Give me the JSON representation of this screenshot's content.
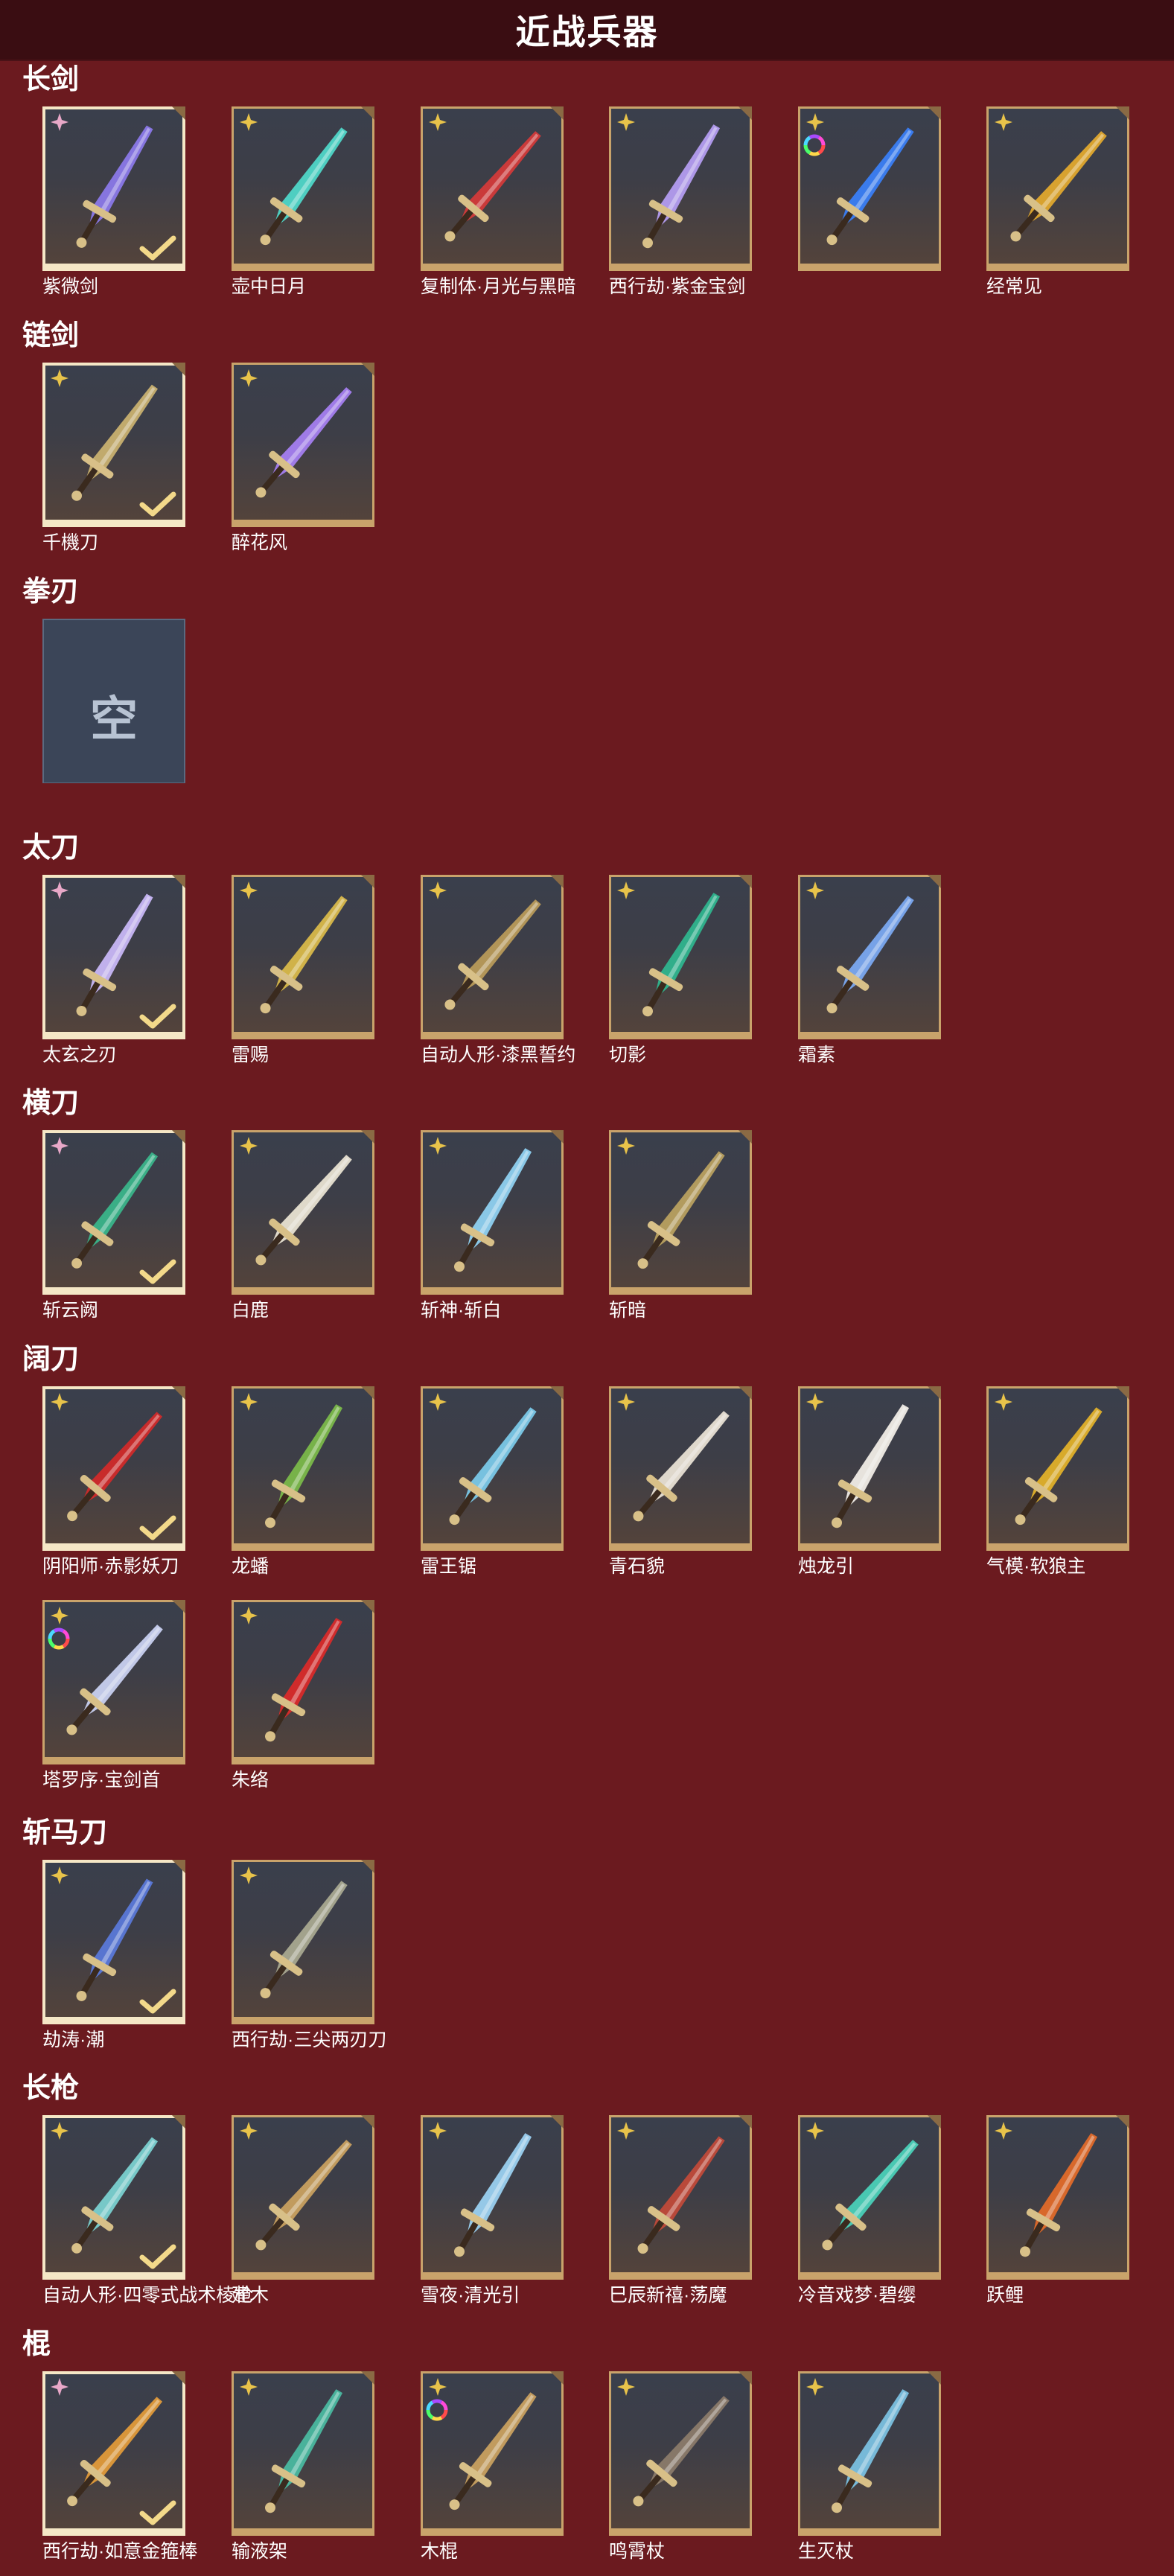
{
  "header": {
    "title": "近战兵器"
  },
  "colors": {
    "background": "#6b1a1f",
    "header_bg": "#3a0d12",
    "card_frame": "#c9a36b",
    "card_frame_selected": "#f5e7c6",
    "rare_tag": "#e8a8c8",
    "normal_tag": "#e8c34a"
  },
  "categories": [
    {
      "title": "长剑",
      "items": [
        {
          "name": "紫微剑",
          "selected": true,
          "tag": "pink-star-icon",
          "art_color": "#8a78e8",
          "ring": false
        },
        {
          "name": "壶中日月",
          "selected": false,
          "tag": "gold-star-icon",
          "art_color": "#4fd6c8",
          "ring": false
        },
        {
          "name": "复制体·月光与黑暗",
          "selected": false,
          "tag": "gold-star-icon",
          "art_color": "#d23a3a",
          "ring": false
        },
        {
          "name": "西行劫·紫金宝剑",
          "selected": false,
          "tag": "gold-star-icon",
          "art_color": "#b39cf0",
          "ring": false
        },
        {
          "name": "",
          "selected": false,
          "tag": "gold-star-icon",
          "art_color": "#3a7ef5",
          "ring": true
        },
        {
          "name": "经常见",
          "selected": false,
          "tag": "gold-star-icon",
          "art_color": "#e0a82e",
          "ring": false
        }
      ]
    },
    {
      "title": "链剑",
      "items": [
        {
          "name": "千機刀",
          "selected": true,
          "tag": "gold-star-icon",
          "art_color": "#c8b070",
          "ring": false
        },
        {
          "name": "醉花风",
          "selected": false,
          "tag": "gold-star-icon",
          "art_color": "#a47ef0",
          "ring": false
        }
      ]
    },
    {
      "title": "拳刃",
      "empty": true,
      "empty_label": "空",
      "items": []
    },
    {
      "title": "太刀",
      "items": [
        {
          "name": "太玄之刃",
          "selected": true,
          "tag": "pink-star-icon",
          "art_color": "#c7b6f5",
          "ring": false
        },
        {
          "name": "雷赐",
          "selected": false,
          "tag": "gold-star-icon",
          "art_color": "#d8b84a",
          "ring": false
        },
        {
          "name": "自动人形·漆黑誓约",
          "selected": false,
          "tag": "gold-star-icon",
          "art_color": "#b89a5a",
          "ring": false
        },
        {
          "name": "切影",
          "selected": false,
          "tag": "gold-star-icon",
          "art_color": "#2fb48e",
          "ring": false
        },
        {
          "name": "霜素",
          "selected": false,
          "tag": "gold-star-icon",
          "art_color": "#7aa8f0",
          "ring": false
        }
      ]
    },
    {
      "title": "横刀",
      "items": [
        {
          "name": "斩云阙",
          "selected": true,
          "tag": "pink-star-icon",
          "art_color": "#3ab48a",
          "ring": false
        },
        {
          "name": "白鹿",
          "selected": false,
          "tag": "gold-star-icon",
          "art_color": "#e8e2d2",
          "ring": false
        },
        {
          "name": "斩神·斩白",
          "selected": false,
          "tag": "gold-star-icon",
          "art_color": "#8ed0f0",
          "ring": false
        },
        {
          "name": "斩暗",
          "selected": false,
          "tag": "gold-star-icon",
          "art_color": "#b8a060",
          "ring": false
        }
      ]
    },
    {
      "title": "阔刀",
      "items": [
        {
          "name": "阴阳师·赤影妖刀",
          "selected": true,
          "tag": "gold-star-icon",
          "art_color": "#d02a2a",
          "ring": false
        },
        {
          "name": "龙蟠",
          "selected": false,
          "tag": "gold-star-icon",
          "art_color": "#7ab84a",
          "ring": false
        },
        {
          "name": "雷王锯",
          "selected": false,
          "tag": "gold-star-icon",
          "art_color": "#7ac8e8",
          "ring": false
        },
        {
          "name": "青石貌",
          "selected": false,
          "tag": "gold-star-icon",
          "art_color": "#e8e0d4",
          "ring": false
        },
        {
          "name": "烛龙引",
          "selected": false,
          "tag": "gold-star-icon",
          "art_color": "#f0ece6",
          "ring": false
        },
        {
          "name": "气模·软狼主",
          "selected": false,
          "tag": "gold-star-icon",
          "art_color": "#e0b02a",
          "ring": false
        },
        {
          "name": "塔罗序·宝剑首",
          "selected": false,
          "tag": "gold-star-icon",
          "art_color": "#c8d0f0",
          "ring": true
        },
        {
          "name": "朱络",
          "selected": false,
          "tag": "gold-star-icon",
          "art_color": "#d82a2a",
          "ring": false
        }
      ]
    },
    {
      "title": "斩马刀",
      "items": [
        {
          "name": "劫涛·潮",
          "selected": true,
          "tag": "gold-star-icon",
          "art_color": "#5a78d8",
          "ring": false
        },
        {
          "name": "西行劫·三尖两刃刀",
          "selected": false,
          "tag": "gold-star-icon",
          "art_color": "#a8a890",
          "ring": false
        }
      ]
    },
    {
      "title": "长枪",
      "items": [
        {
          "name": "自动人形·四零式战术棱枪",
          "selected": true,
          "tag": "gold-star-icon",
          "art_color": "#7ad0d0",
          "ring": false
        },
        {
          "name": "建木",
          "selected": false,
          "tag": "gold-star-icon",
          "art_color": "#c8a060",
          "ring": false
        },
        {
          "name": "雪夜·清光引",
          "selected": false,
          "tag": "gold-star-icon",
          "art_color": "#9ad0f0",
          "ring": false
        },
        {
          "name": "巳辰新禧·荡魔",
          "selected": false,
          "tag": "gold-star-icon",
          "art_color": "#c04a3a",
          "ring": false
        },
        {
          "name": "冷音戏梦·碧缨",
          "selected": false,
          "tag": "gold-star-icon",
          "art_color": "#4ad0b8",
          "ring": false
        },
        {
          "name": "跃鲤",
          "selected": false,
          "tag": "gold-star-icon",
          "art_color": "#e06a2a",
          "ring": false
        }
      ]
    },
    {
      "title": "棍",
      "items": [
        {
          "name": "西行劫·如意金箍棒",
          "selected": true,
          "tag": "pink-star-icon",
          "art_color": "#e09a3a",
          "ring": false
        },
        {
          "name": "输液架",
          "selected": false,
          "tag": "gold-star-icon",
          "art_color": "#4ab8a0",
          "ring": false
        },
        {
          "name": "木棍",
          "selected": false,
          "tag": "gold-star-icon",
          "art_color": "#c8a060",
          "ring": true
        },
        {
          "name": "鸣霄杖",
          "selected": false,
          "tag": "gold-star-icon",
          "art_color": "#8a7a6a",
          "ring": false
        },
        {
          "name": "生灭杖",
          "selected": false,
          "tag": "gold-star-icon",
          "art_color": "#7ac0e0",
          "ring": false
        }
      ]
    }
  ]
}
